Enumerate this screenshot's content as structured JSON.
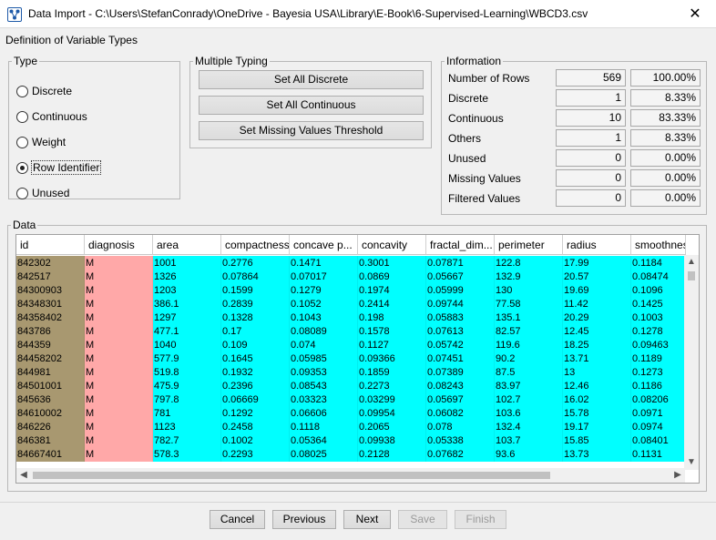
{
  "window": {
    "title": "Data Import - C:\\Users\\StefanConrady\\OneDrive - Bayesia USA\\Library\\E-Book\\6-Supervised-Learning\\WBCD3.csv",
    "close_glyph": "✕",
    "subtitle": "Definition of Variable Types"
  },
  "type_group": {
    "legend": "Type",
    "options": [
      {
        "label": "Discrete",
        "checked": false
      },
      {
        "label": "Continuous",
        "checked": false
      },
      {
        "label": "Weight",
        "checked": false
      },
      {
        "label": "Row Identifier",
        "checked": true
      },
      {
        "label": "Unused",
        "checked": false
      }
    ]
  },
  "multiple_typing": {
    "legend": "Multiple Typing",
    "set_all_discrete": "Set All Discrete",
    "set_all_continuous": "Set All Continuous",
    "set_missing_threshold": "Set Missing Values Threshold"
  },
  "information": {
    "legend": "Information",
    "rows": [
      {
        "label": "Number of Rows",
        "count": "569",
        "percent": "100.00%"
      },
      {
        "label": "Discrete",
        "count": "1",
        "percent": "8.33%"
      },
      {
        "label": "Continuous",
        "count": "10",
        "percent": "83.33%"
      },
      {
        "label": "Others",
        "count": "1",
        "percent": "8.33%"
      },
      {
        "label": "Unused",
        "count": "0",
        "percent": "0.00%"
      },
      {
        "label": "Missing Values",
        "count": "0",
        "percent": "0.00%"
      },
      {
        "label": "Filtered Values",
        "count": "0",
        "percent": "0.00%"
      }
    ]
  },
  "data_group": {
    "legend": "Data",
    "columns": [
      "id",
      "diagnosis",
      "area",
      "compactness",
      "concave p...",
      "concavity",
      "fractal_dim...",
      "perimeter",
      "radius",
      "smoothness"
    ],
    "column_colors": [
      "#a89870",
      "#ffa8a8",
      "#00ffff",
      "#00ffff",
      "#00ffff",
      "#00ffff",
      "#00ffff",
      "#00ffff",
      "#00ffff",
      "#00ffff"
    ],
    "rows": [
      [
        "842302",
        "M",
        "1001",
        "0.2776",
        "0.1471",
        "0.3001",
        "0.07871",
        "122.8",
        "17.99",
        "0.1184"
      ],
      [
        "842517",
        "M",
        "1326",
        "0.07864",
        "0.07017",
        "0.0869",
        "0.05667",
        "132.9",
        "20.57",
        "0.08474"
      ],
      [
        "84300903",
        "M",
        "1203",
        "0.1599",
        "0.1279",
        "0.1974",
        "0.05999",
        "130",
        "19.69",
        "0.1096"
      ],
      [
        "84348301",
        "M",
        "386.1",
        "0.2839",
        "0.1052",
        "0.2414",
        "0.09744",
        "77.58",
        "11.42",
        "0.1425"
      ],
      [
        "84358402",
        "M",
        "1297",
        "0.1328",
        "0.1043",
        "0.198",
        "0.05883",
        "135.1",
        "20.29",
        "0.1003"
      ],
      [
        "843786",
        "M",
        "477.1",
        "0.17",
        "0.08089",
        "0.1578",
        "0.07613",
        "82.57",
        "12.45",
        "0.1278"
      ],
      [
        "844359",
        "M",
        "1040",
        "0.109",
        "0.074",
        "0.1127",
        "0.05742",
        "119.6",
        "18.25",
        "0.09463"
      ],
      [
        "84458202",
        "M",
        "577.9",
        "0.1645",
        "0.05985",
        "0.09366",
        "0.07451",
        "90.2",
        "13.71",
        "0.1189"
      ],
      [
        "844981",
        "M",
        "519.8",
        "0.1932",
        "0.09353",
        "0.1859",
        "0.07389",
        "87.5",
        "13",
        "0.1273"
      ],
      [
        "84501001",
        "M",
        "475.9",
        "0.2396",
        "0.08543",
        "0.2273",
        "0.08243",
        "83.97",
        "12.46",
        "0.1186"
      ],
      [
        "845636",
        "M",
        "797.8",
        "0.06669",
        "0.03323",
        "0.03299",
        "0.05697",
        "102.7",
        "16.02",
        "0.08206"
      ],
      [
        "84610002",
        "M",
        "781",
        "0.1292",
        "0.06606",
        "0.09954",
        "0.06082",
        "103.6",
        "15.78",
        "0.0971"
      ],
      [
        "846226",
        "M",
        "1123",
        "0.2458",
        "0.1118",
        "0.2065",
        "0.078",
        "132.4",
        "19.17",
        "0.0974"
      ],
      [
        "846381",
        "M",
        "782.7",
        "0.1002",
        "0.05364",
        "0.09938",
        "0.05338",
        "103.7",
        "15.85",
        "0.08401"
      ],
      [
        "84667401",
        "M",
        "578.3",
        "0.2293",
        "0.08025",
        "0.2128",
        "0.07682",
        "93.6",
        "13.73",
        "0.1131"
      ]
    ]
  },
  "footer": {
    "cancel": "Cancel",
    "previous": "Previous",
    "next": "Next",
    "save": "Save",
    "finish": "Finish"
  }
}
